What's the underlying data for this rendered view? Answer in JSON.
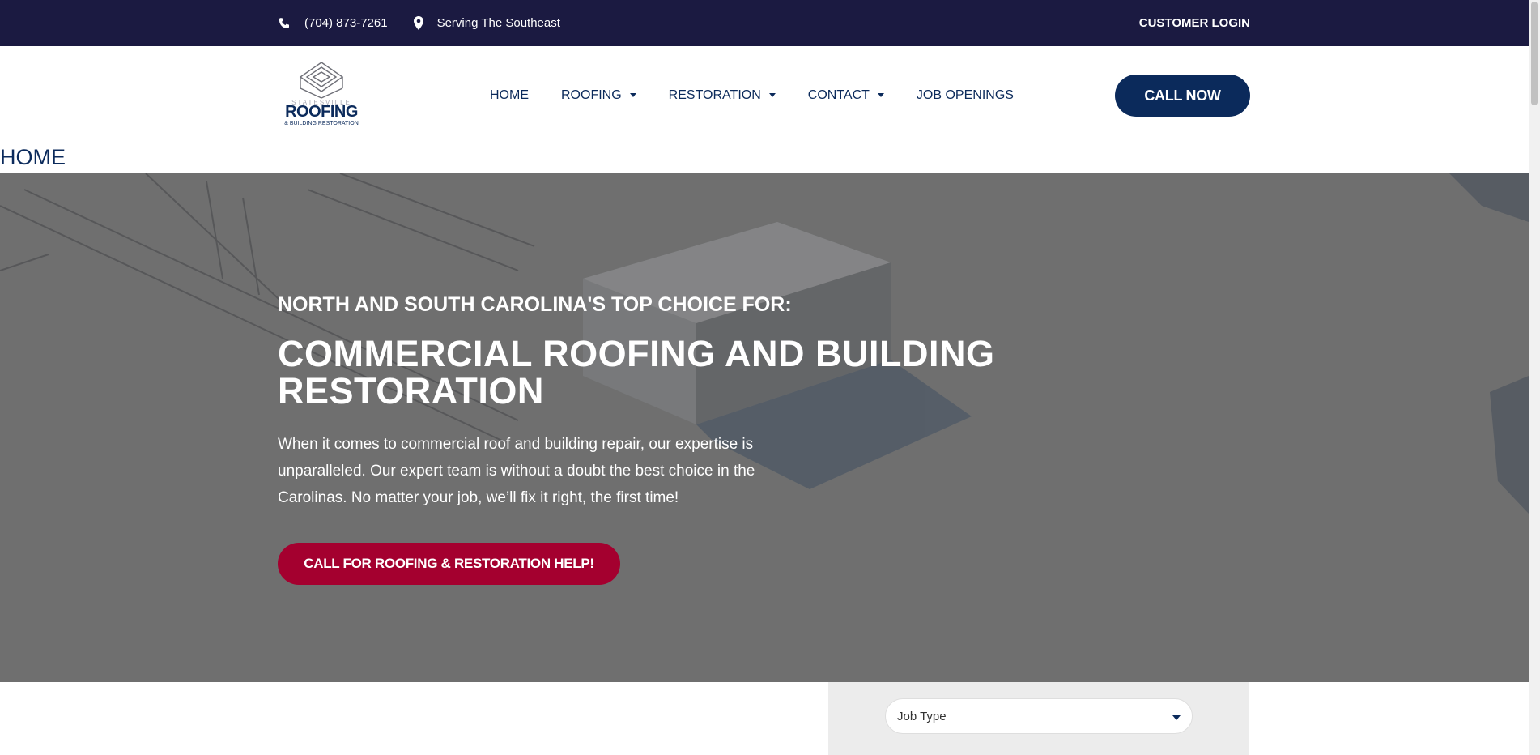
{
  "topbar": {
    "phone": "(704) 873-7261",
    "phone_icon": "phone-icon",
    "location": "Serving The Southeast",
    "location_icon": "map-marker-icon",
    "login": "CUSTOMER LOGIN"
  },
  "logo": {
    "line1": "STATESVILLE",
    "line2": "ROOFING",
    "line3": "& BUILDING RESTORATION"
  },
  "nav": {
    "items": [
      {
        "label": "HOME",
        "has_dropdown": false
      },
      {
        "label": "ROOFING",
        "has_dropdown": true
      },
      {
        "label": "RESTORATION",
        "has_dropdown": true
      },
      {
        "label": "CONTACT",
        "has_dropdown": true
      },
      {
        "label": "JOB OPENINGS",
        "has_dropdown": false
      }
    ]
  },
  "header": {
    "call_now": "CALL NOW"
  },
  "page": {
    "title": "HOME"
  },
  "hero": {
    "eyebrow": "NORTH AND SOUTH CAROLINA'S TOP CHOICE FOR:",
    "headline": "COMMERCIAL ROOFING AND BUILDING RESTORATION",
    "description": "When it comes to commercial roof and building repair, our expertise is unparalleled. Our expert team is without a doubt the best choice in the Carolinas. No matter your job, we’ll fix it right, the first time!",
    "cta": "CALL FOR ROOFING & RESTORATION HELP!"
  },
  "form": {
    "job_type": "Job Type"
  },
  "colors": {
    "topbar_bg": "#1b1a41",
    "brand_navy": "#0b2a5b",
    "cta_red": "#a4002f",
    "hero_overlay": "#6e6f6f"
  }
}
